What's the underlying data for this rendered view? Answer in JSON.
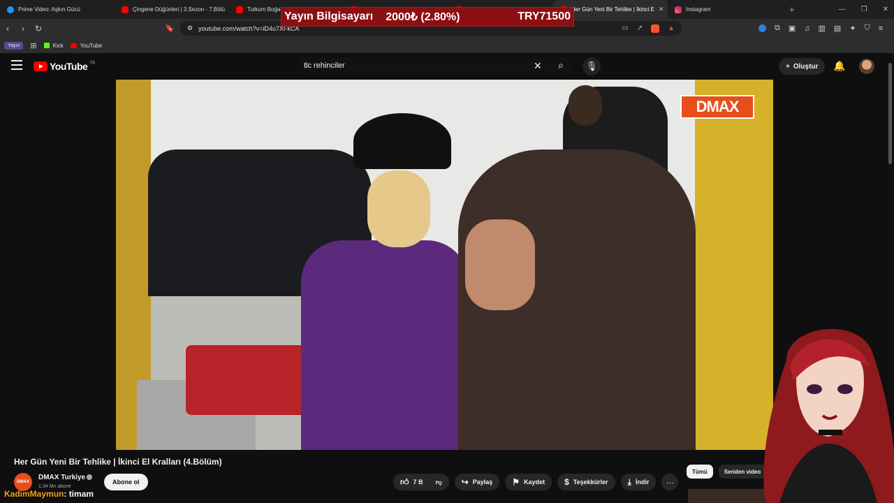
{
  "browser": {
    "tabs": [
      {
        "label": "Prime Video: Aşkın Gücü",
        "icon": "prime-video-icon",
        "active": false
      },
      {
        "label": "Çingene Düğünleri | 3.Sezon - 7.Bölü",
        "icon": "youtube-icon",
        "active": false
      },
      {
        "label": "Tutkum Boğa",
        "icon": "youtube-icon",
        "active": false
      },
      {
        "label": "",
        "icon": "youtube-icon",
        "active": false
      },
      {
        "label": "",
        "icon": "youtube-icon",
        "active": false
      },
      {
        "label": "Her Gün Yeni Bir Tehlike | İkinci E",
        "icon": "youtube-icon",
        "active": true
      },
      {
        "label": "Instagram",
        "icon": "instagram-icon",
        "active": false
      }
    ],
    "url": "youtube.com/watch?v=iD4u7XI-kCA",
    "bookmarks": {
      "folder": "Yayın",
      "items": [
        "Kick",
        "YouTube"
      ]
    }
  },
  "stream_banner": {
    "label": "Yayın Bilgisayarı",
    "change": "2000₺ (2.80%)",
    "total": "TRY71500"
  },
  "youtube": {
    "country_code": "TR",
    "search_query": "tlc rehinciler",
    "create_label": "Oluştur"
  },
  "video": {
    "channel_logo": "DMAX",
    "title": "Her Gün Yeni Bir Tehlike | İkinci El Kralları (4.Bölüm)",
    "channel": {
      "name": "DMAX Turkiye",
      "avatar_text": "DMAX",
      "subscribers": "1,34 Mn abone",
      "subscribe_label": "Abone ol"
    },
    "actions": {
      "likes": "7 B",
      "share": "Paylaş",
      "save": "Kaydet",
      "thanks": "Teşekkürler",
      "download": "İndir"
    }
  },
  "related": {
    "chips": [
      "Tümü",
      "Seriden video"
    ]
  },
  "chat": {
    "user": "KadimMaymun",
    "message": ": timam"
  },
  "colors": {
    "youtube_red": "#ff0000",
    "dmax_orange": "#e84e1b",
    "banner_red": "#8c0f12"
  }
}
